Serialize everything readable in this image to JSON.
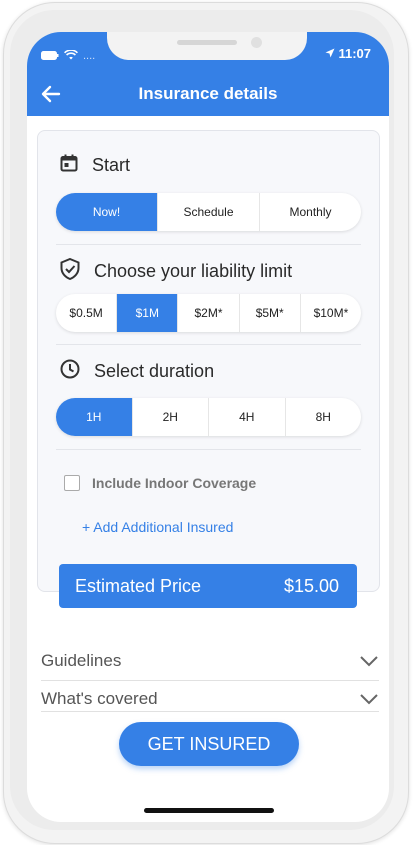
{
  "status": {
    "time": "11:07",
    "carrier": "...."
  },
  "header": {
    "title": "Insurance details"
  },
  "start": {
    "label": "Start",
    "options": [
      "Now!",
      "Schedule",
      "Monthly"
    ],
    "selected": "Now!"
  },
  "liability": {
    "label": "Choose your liability limit",
    "options": [
      "$0.5M",
      "$1M",
      "$2M*",
      "$5M*",
      "$10M*"
    ],
    "selected": "$1M"
  },
  "duration": {
    "label": "Select duration",
    "options": [
      "1H",
      "2H",
      "4H",
      "8H"
    ],
    "selected": "1H"
  },
  "indoor": {
    "label": "Include Indoor Coverage",
    "checked": false
  },
  "add_insured": {
    "label": "+ Add Additional Insured"
  },
  "price": {
    "label": "Estimated Price",
    "value": "$15.00"
  },
  "accordion": [
    {
      "label": "Guidelines"
    },
    {
      "label": "What's covered"
    }
  ],
  "cta": {
    "label": "GET INSURED"
  },
  "colors": {
    "accent": "#3580e6"
  }
}
